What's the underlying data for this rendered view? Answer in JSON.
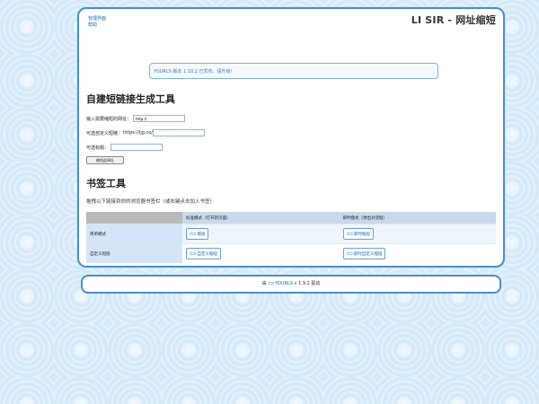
{
  "nav": {
    "admin": "管理界面",
    "help": "帮助"
  },
  "site_title": "LI SIR - 网址缩短",
  "notice": "YOURLS 版本 1.10.2 已发布，请升级！",
  "shorten": {
    "title": "自建短链接生成工具",
    "url_label": "输入需要缩短的网址：",
    "url_value": "http://",
    "keyword_label": "可选自定义短链：",
    "keyword_prefix": "https://ljg.co/",
    "title_label": "可选标题：",
    "submit_label": "缩短此网址"
  },
  "bookmarklet": {
    "title": "书签工具",
    "desc": "拖拽以下链接到你的浏览器书签栏（或右键点击加入书签）",
    "headers": [
      "",
      "标准模式（打开新页面）",
      "即时模式（弹出对话框）"
    ],
    "rows": [
      {
        "label": "简单模式",
        "standard": "缩短",
        "instant": "即时缩短"
      },
      {
        "label": "自定义短链",
        "standard": "自定义缩短",
        "instant": "即时自定义缩短"
      }
    ],
    "link_icon": "link-icon"
  },
  "footer": {
    "prefix": "由",
    "brand": "YOURLS",
    "suffix": "v 1.9.2 驱动"
  },
  "colors": {
    "border": "#4a8fc7",
    "link": "#1a6db5",
    "background": "#d4e9fa"
  }
}
